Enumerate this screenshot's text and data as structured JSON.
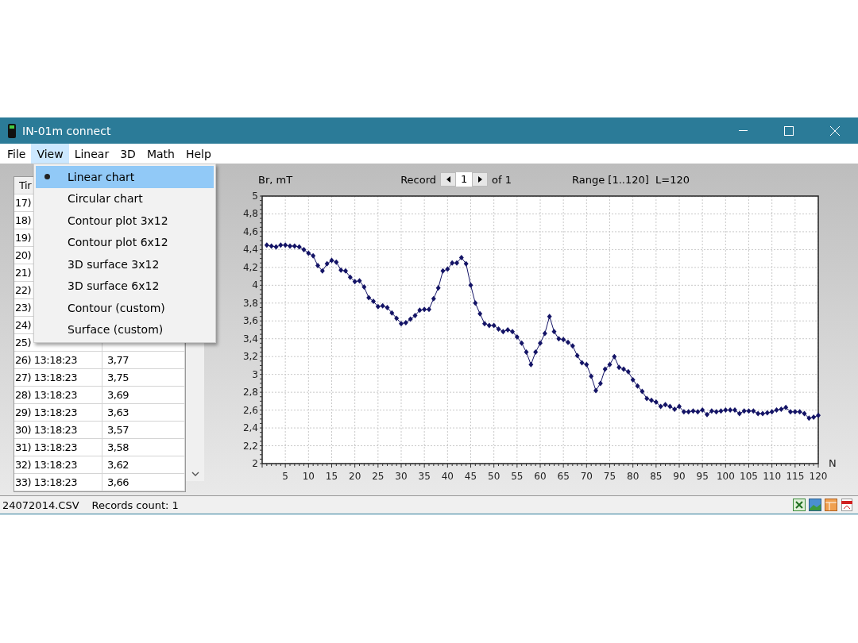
{
  "window": {
    "title": "IN-01m connect"
  },
  "menu_bar": [
    {
      "label": "File",
      "selected": false
    },
    {
      "label": "View",
      "selected": true
    },
    {
      "label": "Linear",
      "selected": false
    },
    {
      "label": "3D",
      "selected": false
    },
    {
      "label": "Math",
      "selected": false
    },
    {
      "label": "Help",
      "selected": false
    }
  ],
  "view_menu": [
    {
      "label": "Linear chart",
      "selected": true
    },
    {
      "label": "Circular chart",
      "selected": false
    },
    {
      "label": "Contour plot 3x12",
      "selected": false
    },
    {
      "label": "Contour plot 6x12",
      "selected": false
    },
    {
      "label": "3D surface 3x12",
      "selected": false
    },
    {
      "label": "3D surface 6x12",
      "selected": false
    },
    {
      "label": "Contour (custom)",
      "selected": false
    },
    {
      "label": "Surface (custom)",
      "selected": false
    }
  ],
  "table": {
    "columns": [
      "Tir"
    ],
    "rows": [
      {
        "time": "17)"
      },
      {
        "time": "18)"
      },
      {
        "time": "19)"
      },
      {
        "time": "20)"
      },
      {
        "time": "21)"
      },
      {
        "time": "22)"
      },
      {
        "time": "23)"
      },
      {
        "time": "24)"
      },
      {
        "time": "25)"
      },
      {
        "time": "26) 13:18:23",
        "value": "3,77"
      },
      {
        "time": "27) 13:18:23",
        "value": "3,75"
      },
      {
        "time": "28) 13:18:23",
        "value": "3,69"
      },
      {
        "time": "29) 13:18:23",
        "value": "3,63"
      },
      {
        "time": "30) 13:18:23",
        "value": "3,57"
      },
      {
        "time": "31) 13:18:23",
        "value": "3,58"
      },
      {
        "time": "32) 13:18:23",
        "value": "3,62"
      },
      {
        "time": "33) 13:18:23",
        "value": "3,66"
      }
    ]
  },
  "chart_header": {
    "record_label": "Record",
    "record_value": "1",
    "record_total": "of 1",
    "range": "Range [1..120]  L=120"
  },
  "chart": {
    "chart_data": {
      "type": "line",
      "xlabel": "N",
      "ylabel": "Br, mT",
      "x": [
        1,
        2,
        3,
        4,
        5,
        6,
        7,
        8,
        9,
        10,
        11,
        12,
        13,
        14,
        15,
        16,
        17,
        18,
        19,
        20,
        21,
        22,
        23,
        24,
        25,
        26,
        27,
        28,
        29,
        30,
        31,
        32,
        33,
        34,
        35,
        36,
        37,
        38,
        39,
        40,
        41,
        42,
        43,
        44,
        45,
        46,
        47,
        48,
        49,
        50,
        51,
        52,
        53,
        54,
        55,
        56,
        57,
        58,
        59,
        60,
        61,
        62,
        63,
        64,
        65,
        66,
        67,
        68,
        69,
        70,
        71,
        72,
        73,
        74,
        75,
        76,
        77,
        78,
        79,
        80,
        81,
        82,
        83,
        84,
        85,
        86,
        87,
        88,
        89,
        90,
        91,
        92,
        93,
        94,
        95,
        96,
        97,
        98,
        99,
        100,
        101,
        102,
        103,
        104,
        105,
        106,
        107,
        108,
        109,
        110,
        111,
        112,
        113,
        114,
        115,
        116,
        117,
        118,
        119,
        120
      ],
      "grid": true,
      "series": [
        {
          "color": "#141466",
          "marker": "diamond",
          "values": [
            4.45,
            4.44,
            4.43,
            4.45,
            4.45,
            4.44,
            4.44,
            4.43,
            4.4,
            4.36,
            4.33,
            4.22,
            4.16,
            4.24,
            4.28,
            4.26,
            4.17,
            4.16,
            4.09,
            4.04,
            4.05,
            3.98,
            3.86,
            3.82,
            3.76,
            3.77,
            3.75,
            3.69,
            3.63,
            3.57,
            3.58,
            3.62,
            3.66,
            3.72,
            3.73,
            3.73,
            3.85,
            3.97,
            4.16,
            4.18,
            4.25,
            4.25,
            4.31,
            4.24,
            4.0,
            3.8,
            3.68,
            3.57,
            3.55,
            3.55,
            3.51,
            3.48,
            3.5,
            3.48,
            3.42,
            3.35,
            3.25,
            3.11,
            3.25,
            3.35,
            3.46,
            3.65,
            3.48,
            3.4,
            3.39,
            3.36,
            3.32,
            3.21,
            3.13,
            3.11,
            2.98,
            2.82,
            2.9,
            3.06,
            3.11,
            3.2,
            3.08,
            3.06,
            3.03,
            2.94,
            2.87,
            2.81,
            2.73,
            2.71,
            2.69,
            2.64,
            2.66,
            2.64,
            2.61,
            2.64,
            2.58,
            2.58,
            2.59,
            2.58,
            2.6,
            2.55,
            2.59,
            2.58,
            2.59,
            2.6,
            2.6,
            2.6,
            2.56,
            2.59,
            2.59,
            2.59,
            2.56,
            2.56,
            2.57,
            2.58,
            2.6,
            2.61,
            2.63,
            2.58,
            2.58,
            2.58,
            2.56,
            2.51,
            2.52,
            2.54
          ]
        }
      ],
      "xlim": [
        0,
        120
      ],
      "ylim": [
        2,
        5
      ],
      "xticks": [
        5,
        10,
        15,
        20,
        25,
        30,
        35,
        40,
        45,
        50,
        55,
        60,
        65,
        70,
        75,
        80,
        85,
        90,
        95,
        100,
        105,
        110,
        115,
        120
      ],
      "yticks": [
        {
          "value": 2,
          "label": "2"
        },
        {
          "value": 2.2,
          "label": "2,2"
        },
        {
          "value": 2.4,
          "label": "2,4"
        },
        {
          "value": 2.6,
          "label": "2,6"
        },
        {
          "value": 2.8,
          "label": "2,8"
        },
        {
          "value": 3,
          "label": "3"
        },
        {
          "value": 3.2,
          "label": "3,2"
        },
        {
          "value": 3.4,
          "label": "3,4"
        },
        {
          "value": 3.6,
          "label": "3,6"
        },
        {
          "value": 3.8,
          "label": "3,8"
        },
        {
          "value": 4,
          "label": "4"
        },
        {
          "value": 4.2,
          "label": "4,2"
        },
        {
          "value": 4.4,
          "label": "4,4"
        },
        {
          "value": 4.6,
          "label": "4,6"
        },
        {
          "value": 4.8,
          "label": "4,8"
        },
        {
          "value": 5,
          "label": "5"
        }
      ]
    }
  },
  "status_bar": {
    "file": "24072014.CSV",
    "records": "Records count: 1"
  }
}
